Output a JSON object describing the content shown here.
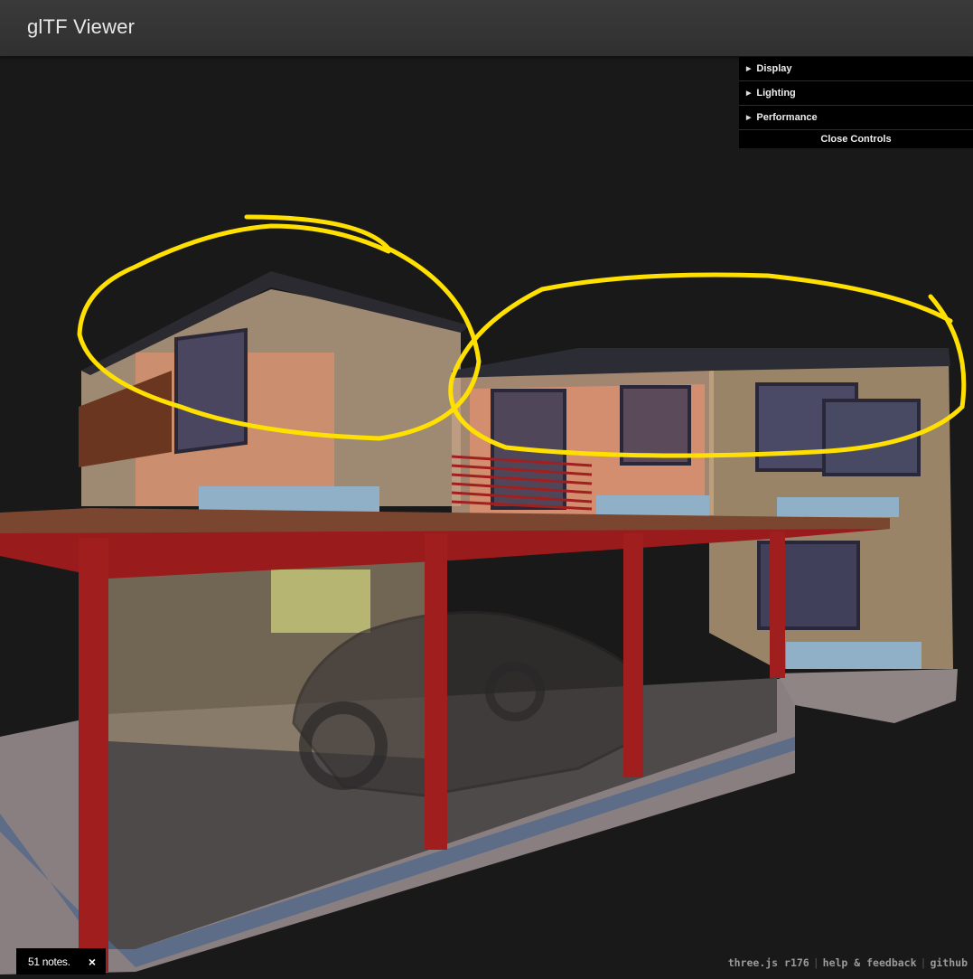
{
  "header": {
    "title": "glTF Viewer"
  },
  "controls": {
    "folders": [
      {
        "label": "Display"
      },
      {
        "label": "Lighting"
      },
      {
        "label": "Performance"
      }
    ],
    "close_label": "Close Controls"
  },
  "notes": {
    "label": "51 notes.",
    "close": "×"
  },
  "footer": {
    "version": "three.js r176",
    "help": "help & feedback",
    "github": "github",
    "separator": "|"
  },
  "colors": {
    "annotation": "#ffe000",
    "background": "#191919",
    "columns": "#9a1b1b"
  }
}
